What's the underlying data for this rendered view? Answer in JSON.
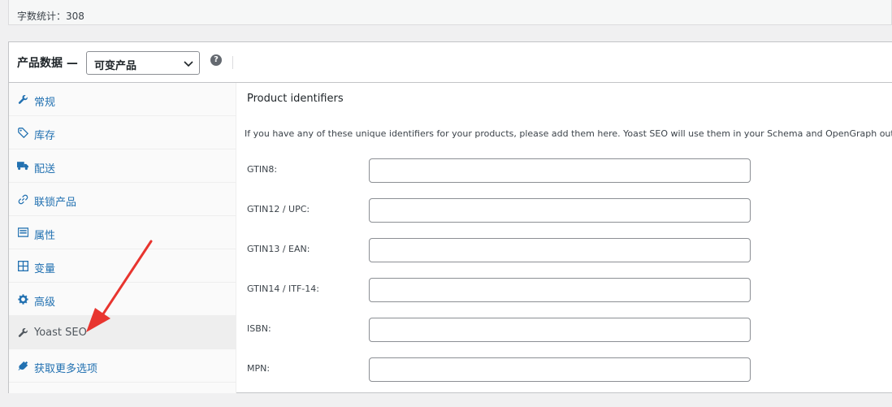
{
  "word_count": {
    "text": "字数统计：308"
  },
  "panel": {
    "title": "产品数据 —",
    "product_type": "可变产品",
    "help_icon_glyph": "?"
  },
  "tabs": [
    {
      "label": "常规",
      "icon": "wrench-icon"
    },
    {
      "label": "库存",
      "icon": "tag-icon"
    },
    {
      "label": "配送",
      "icon": "truck-icon"
    },
    {
      "label": "联锁产品",
      "icon": "link-icon"
    },
    {
      "label": "属性",
      "icon": "list-icon"
    },
    {
      "label": "变量",
      "icon": "grid-icon"
    },
    {
      "label": "高级",
      "icon": "gear-icon"
    },
    {
      "label": "Yoast SEO",
      "icon": "wrench-icon",
      "active": true
    },
    {
      "label": "获取更多选项",
      "icon": "plugin-icon"
    }
  ],
  "content": {
    "heading": "Product identifiers",
    "description": "If you have any of these unique identifiers for your products, please add them here. Yoast SEO will use them in your Schema and OpenGraph output.",
    "fields": [
      {
        "label": "GTIN8:",
        "value": ""
      },
      {
        "label": "GTIN12 / UPC:",
        "value": ""
      },
      {
        "label": "GTIN13 / EAN:",
        "value": ""
      },
      {
        "label": "GTIN14 / ITF-14:",
        "value": ""
      },
      {
        "label": "ISBN:",
        "value": ""
      },
      {
        "label": "MPN:",
        "value": ""
      }
    ]
  },
  "colors": {
    "link": "#2271b1",
    "annotation_arrow": "#e8352f"
  }
}
